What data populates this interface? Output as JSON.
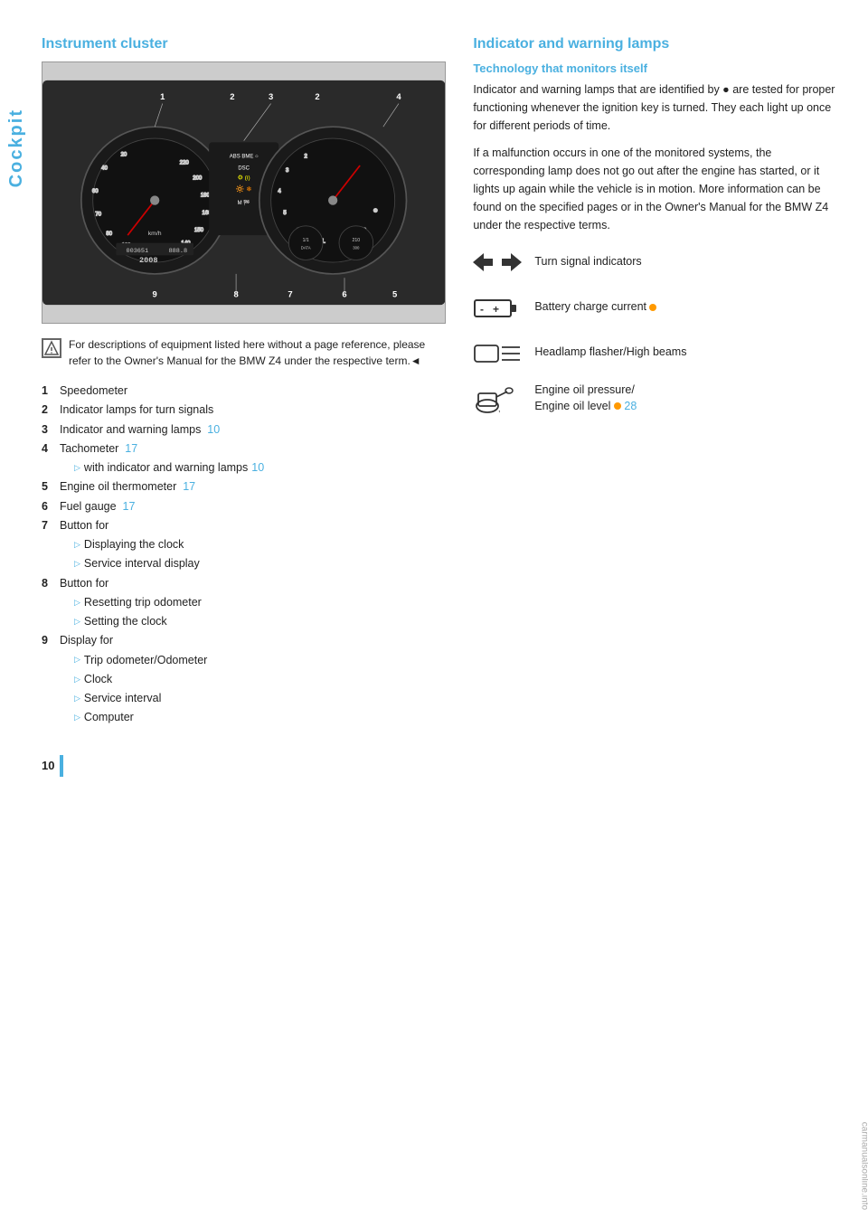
{
  "page": {
    "number": "10",
    "watermark": "carmanualsonline.info",
    "side_tab_label": "Cockpit"
  },
  "left": {
    "section_title": "Instrument cluster",
    "note_text": "For descriptions of equipment listed here without a page reference, please refer to the Owner's Manual for the BMW Z4 under the respective term.◄",
    "items": [
      {
        "num": "1",
        "label": "Speedometer",
        "ref": "",
        "sub": []
      },
      {
        "num": "2",
        "label": "Indicator lamps for turn signals",
        "ref": "",
        "sub": []
      },
      {
        "num": "3",
        "label": "Indicator and warning lamps",
        "ref": "10",
        "sub": []
      },
      {
        "num": "4",
        "label": "Tachometer",
        "ref": "17",
        "sub": [
          "with indicator and warning lamps  10"
        ]
      },
      {
        "num": "5",
        "label": "Engine oil thermometer",
        "ref": "17",
        "sub": []
      },
      {
        "num": "6",
        "label": "Fuel gauge",
        "ref": "17",
        "sub": []
      },
      {
        "num": "7",
        "label": "Button for",
        "ref": "",
        "sub": [
          "Displaying the clock",
          "Service interval display"
        ]
      },
      {
        "num": "8",
        "label": "Button for",
        "ref": "",
        "sub": [
          "Resetting trip odometer",
          "Setting the clock"
        ]
      },
      {
        "num": "9",
        "label": "Display for",
        "ref": "",
        "sub": [
          "Trip odometer/Odometer",
          "Clock",
          "Service interval",
          "Computer"
        ]
      }
    ]
  },
  "right": {
    "section_title": "Indicator and warning lamps",
    "sub_title": "Technology that monitors itself",
    "body1": "Indicator and warning lamps that are identified by ● are tested for proper functioning whenever the ignition key is turned. They each light up once for different periods of time.",
    "body2": "If a malfunction occurs in one of the monitored systems, the corresponding lamp does not go out after the engine has started, or it lights up again while the vehicle is in motion. More information can be found on the specified pages or in the Owner's Manual for the BMW Z4 under the respective terms.",
    "warning_items": [
      {
        "icon_type": "turn_signal",
        "label": "Turn signal indicators"
      },
      {
        "icon_type": "battery",
        "label": "Battery charge current ●"
      },
      {
        "icon_type": "headlamp",
        "label": "Headlamp flasher/High beams"
      },
      {
        "icon_type": "oil",
        "label": "Engine oil pressure/\nEngine oil level ● 28"
      }
    ]
  }
}
